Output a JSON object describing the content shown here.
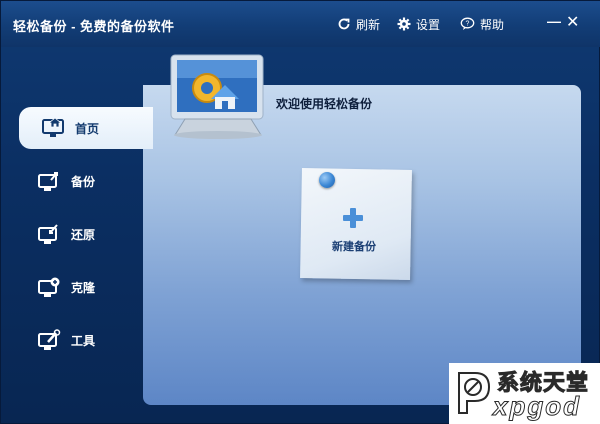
{
  "window": {
    "title": "轻松备份 - 免费的备份软件"
  },
  "toolbar": {
    "refresh_label": "刷新",
    "settings_label": "设置",
    "help_label": "帮助",
    "minimize_glyph": "—",
    "close_glyph": "✕"
  },
  "sidebar": {
    "items": [
      {
        "label": "首页",
        "icon": "home-monitor-icon",
        "active": true
      },
      {
        "label": "备份",
        "icon": "backup-monitor-icon",
        "active": false
      },
      {
        "label": "还原",
        "icon": "restore-monitor-icon",
        "active": false
      },
      {
        "label": "克隆",
        "icon": "clone-monitor-icon",
        "active": false
      },
      {
        "label": "工具",
        "icon": "tools-monitor-icon",
        "active": false
      }
    ]
  },
  "main": {
    "welcome_text": "欢迎使用轻松备份",
    "new_backup_label": "新建备份"
  },
  "watermark": {
    "line1": "系统天堂",
    "line2": "xpgod"
  },
  "colors": {
    "titlebar": "#123d76",
    "window_bg": "#0b2f63",
    "content_top": "#c6d9ef",
    "content_bottom": "#5d86c6",
    "active_nav_bg": "#f7fbff",
    "accent_blue": "#3a86d4"
  }
}
